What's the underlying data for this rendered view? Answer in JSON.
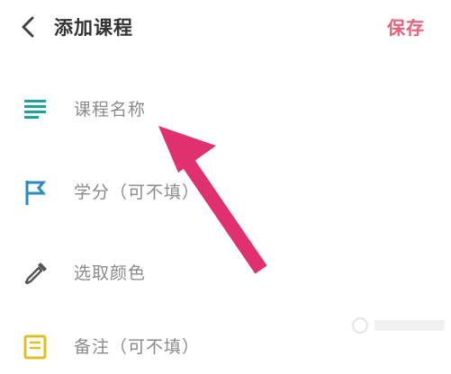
{
  "header": {
    "back_icon": "chevron-left-icon",
    "title": "添加课程",
    "save_label": "保存"
  },
  "fields": [
    {
      "placeholder": "课程名称",
      "icon": "text-lines-icon",
      "icon_color": "#1aa39a"
    },
    {
      "placeholder": "学分（可不填）",
      "icon": "flag-icon",
      "icon_color": "#2a8ac4"
    },
    {
      "placeholder": "选取颜色",
      "icon": "eyedropper-icon",
      "icon_color": "#555555"
    },
    {
      "placeholder": "备注（可不填）",
      "icon": "note-icon",
      "icon_color": "#e0c020"
    }
  ],
  "colors": {
    "accent": "#ec5f7b",
    "arrow": "#e0306e",
    "text": "#333333",
    "placeholder": "#8a8a8a"
  }
}
